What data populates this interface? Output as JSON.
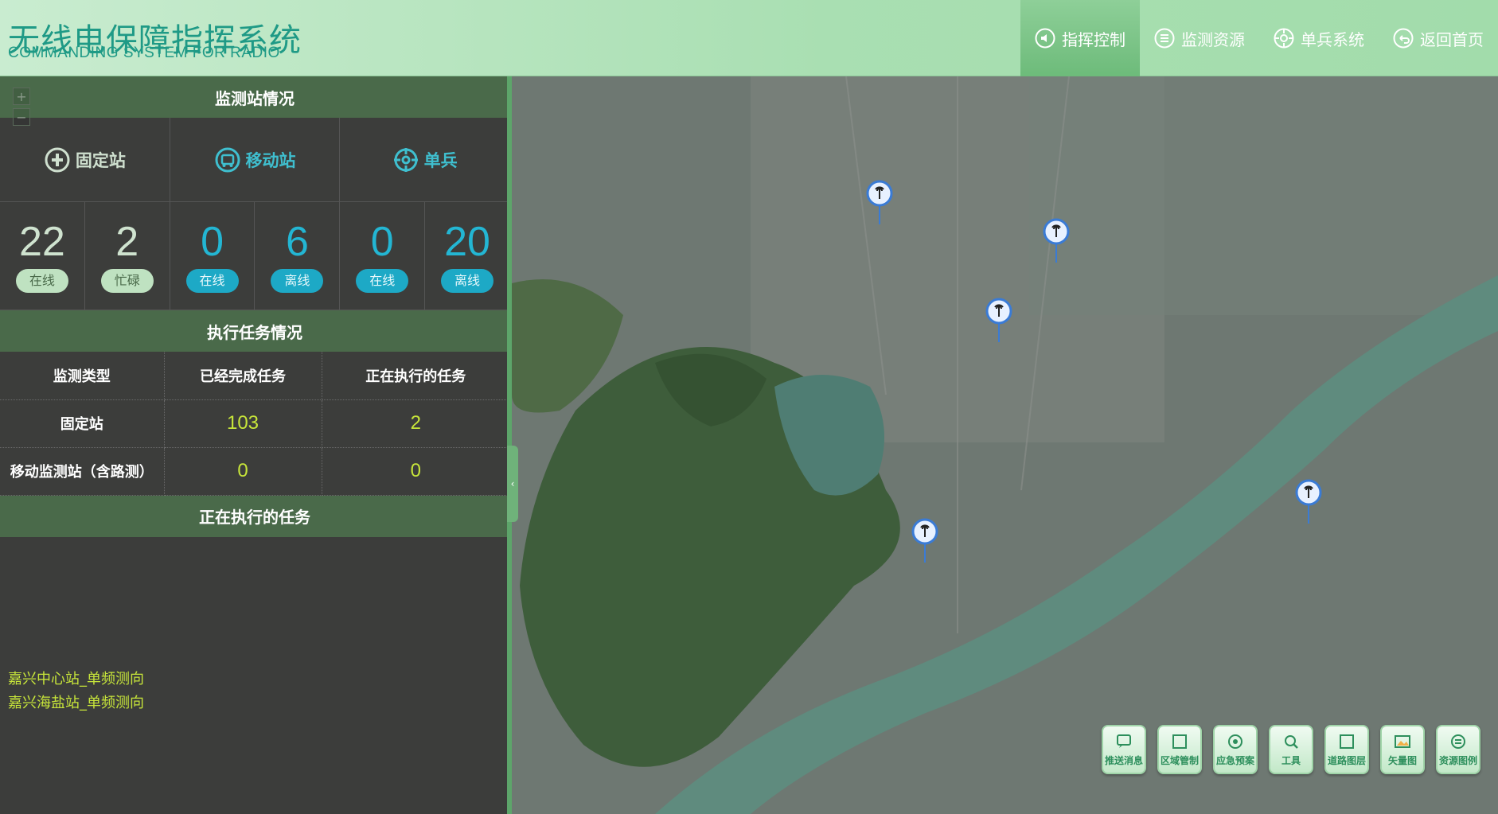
{
  "header": {
    "title_cn": "无线电保障指挥系统",
    "title_en": "COMMANDING SYSTEM FOR RADIO",
    "nav": [
      {
        "label": "指挥控制",
        "icon": "speaker-icon",
        "active": true
      },
      {
        "label": "监测资源",
        "icon": "list-icon",
        "active": false
      },
      {
        "label": "单兵系统",
        "icon": "crosshair-icon",
        "active": false
      },
      {
        "label": "返回首页",
        "icon": "back-icon",
        "active": false
      }
    ]
  },
  "panel": {
    "station_title": "监测站情况",
    "zoom": {
      "plus": "+",
      "minus": "−"
    },
    "stations": [
      {
        "label": "固定站",
        "icon": "fixed-station-icon"
      },
      {
        "label": "移动站",
        "icon": "mobile-station-icon"
      },
      {
        "label": "单兵",
        "icon": "crosshair-icon"
      }
    ],
    "counts": [
      {
        "value": "22",
        "status": "在线"
      },
      {
        "value": "2",
        "status": "忙碌"
      },
      {
        "value": "0",
        "status": "在线"
      },
      {
        "value": "6",
        "status": "离线"
      },
      {
        "value": "0",
        "status": "在线"
      },
      {
        "value": "20",
        "status": "离线"
      }
    ],
    "task_title": "执行任务情况",
    "task_table": {
      "headers": [
        "监测类型",
        "已经完成任务",
        "正在执行的任务"
      ],
      "rows": [
        [
          "固定站",
          "103",
          "2"
        ],
        [
          "移动监测站（含路测）",
          "0",
          "0"
        ]
      ]
    },
    "running_title": "正在执行的任务",
    "running_tasks": [
      "嘉兴中心站_单频测向",
      "嘉兴海盐站_单频测向"
    ]
  },
  "map": {
    "collapse_label": "‹",
    "tools": [
      {
        "label": "推送消息",
        "icon": "message-icon"
      },
      {
        "label": "区域管制",
        "icon": "square-icon"
      },
      {
        "label": "应急预案",
        "icon": "emergency-icon"
      },
      {
        "label": "工具",
        "icon": "tool-icon"
      },
      {
        "label": "道路图层",
        "icon": "square-icon"
      },
      {
        "label": "矢量图",
        "icon": "image-icon"
      },
      {
        "label": "资源图例",
        "icon": "legend-icon"
      }
    ]
  },
  "colors": {
    "header_text": "#1f9a86",
    "accent_green": "#6dbb7a",
    "count_blue": "#23b6d3",
    "task_yellow": "#c7e53a"
  }
}
